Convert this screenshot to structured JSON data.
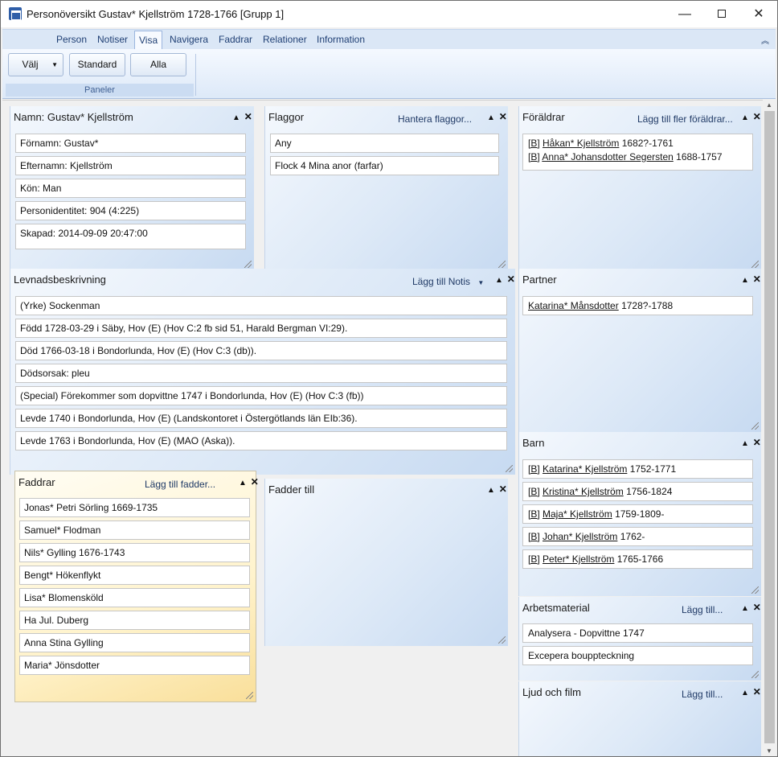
{
  "window": {
    "title": "Personöversikt Gustav* Kjellström 1728-1766 [Grupp 1]",
    "minimize": "—",
    "close": "✕"
  },
  "ribbon": {
    "tabs": [
      "Person",
      "Notiser",
      "Visa",
      "Navigera",
      "Faddrar",
      "Relationer",
      "Information"
    ],
    "active_tab": "Visa",
    "buttons": {
      "valj": "Välj",
      "standard": "Standard",
      "alla": "Alla"
    },
    "group_label": "Paneler"
  },
  "panels": {
    "namn": {
      "title": "Namn: Gustav* Kjellström",
      "fields": [
        "Förnamn: Gustav*",
        "Efternamn: Kjellström",
        "Kön: Man",
        "Personidentitet: 904 (4:225)",
        "Skapad: 2014-09-09 20:47:00"
      ]
    },
    "flaggor": {
      "title": "Flaggor",
      "link": "Hantera flaggor...",
      "items": [
        "Any",
        "Flock 4 Mina anor (farfar)"
      ]
    },
    "foraldrar": {
      "title": "Föräldrar",
      "link": "Lägg till fler föräldrar...",
      "items": [
        {
          "tag": "[B]",
          "name": "Håkan* Kjellström",
          "years": "1682?-1761"
        },
        {
          "tag": "[B]",
          "name": "Anna* Johansdotter Segersten",
          "years": "1688-1757"
        }
      ]
    },
    "levnad": {
      "title": "Levnadsbeskrivning",
      "link": "Lägg till Notis",
      "items": [
        "(Yrke) Sockenman",
        "Född 1728-03-29 i Säby, Hov (E) (Hov C:2 fb sid 51, Harald Bergman VI:29).",
        "Död 1766-03-18 i Bondorlunda, Hov (E) (Hov C:3 (db)).",
        "Dödsorsak: pleu",
        "(Special) Förekommer som dopvittne 1747 i Bondorlunda, Hov (E) (Hov C:3 (fb))",
        "Levde 1740 i Bondorlunda, Hov (E) (Landskontoret i Östergötlands län EIb:36).",
        "Levde 1763 i Bondorlunda, Hov (E) (MAO (Aska))."
      ]
    },
    "partner": {
      "title": "Partner",
      "items": [
        {
          "name": "Katarina* Månsdotter",
          "years": "1728?-1788"
        }
      ]
    },
    "faddrar": {
      "title": "Faddrar",
      "link": "Lägg till fadder...",
      "items": [
        "Jonas* Petri Sörling 1669-1735",
        "Samuel* Flodman",
        "Nils* Gylling 1676-1743",
        "Bengt* Hökenflykt",
        "Lisa* Blomensköld",
        "Ha Jul. Duberg",
        "Anna Stina Gylling",
        "Maria* Jönsdotter"
      ]
    },
    "fadder_till": {
      "title": "Fadder till"
    },
    "barn": {
      "title": "Barn",
      "items": [
        {
          "tag": "[B]",
          "name": "Katarina* Kjellström",
          "years": "1752-1771"
        },
        {
          "tag": "[B]",
          "name": "Kristina* Kjellström",
          "years": "1756-1824"
        },
        {
          "tag": "[B]",
          "name": "Maja* Kjellström",
          "years": "1759-1809-"
        },
        {
          "tag": "[B]",
          "name": "Johan* Kjellström",
          "years": "1762-"
        },
        {
          "tag": "[B]",
          "name": "Peter* Kjellström",
          "years": "1765-1766"
        }
      ]
    },
    "arbetsmaterial": {
      "title": "Arbetsmaterial",
      "link": "Lägg till...",
      "items": [
        "Analysera - Dopvittne 1747",
        "Excepera bouppteckning"
      ]
    },
    "ljud": {
      "title": "Ljud och film",
      "link": "Lägg till..."
    }
  },
  "panel_controls": {
    "collapse": "▲",
    "close": "✕",
    "dropdown": "▼"
  }
}
